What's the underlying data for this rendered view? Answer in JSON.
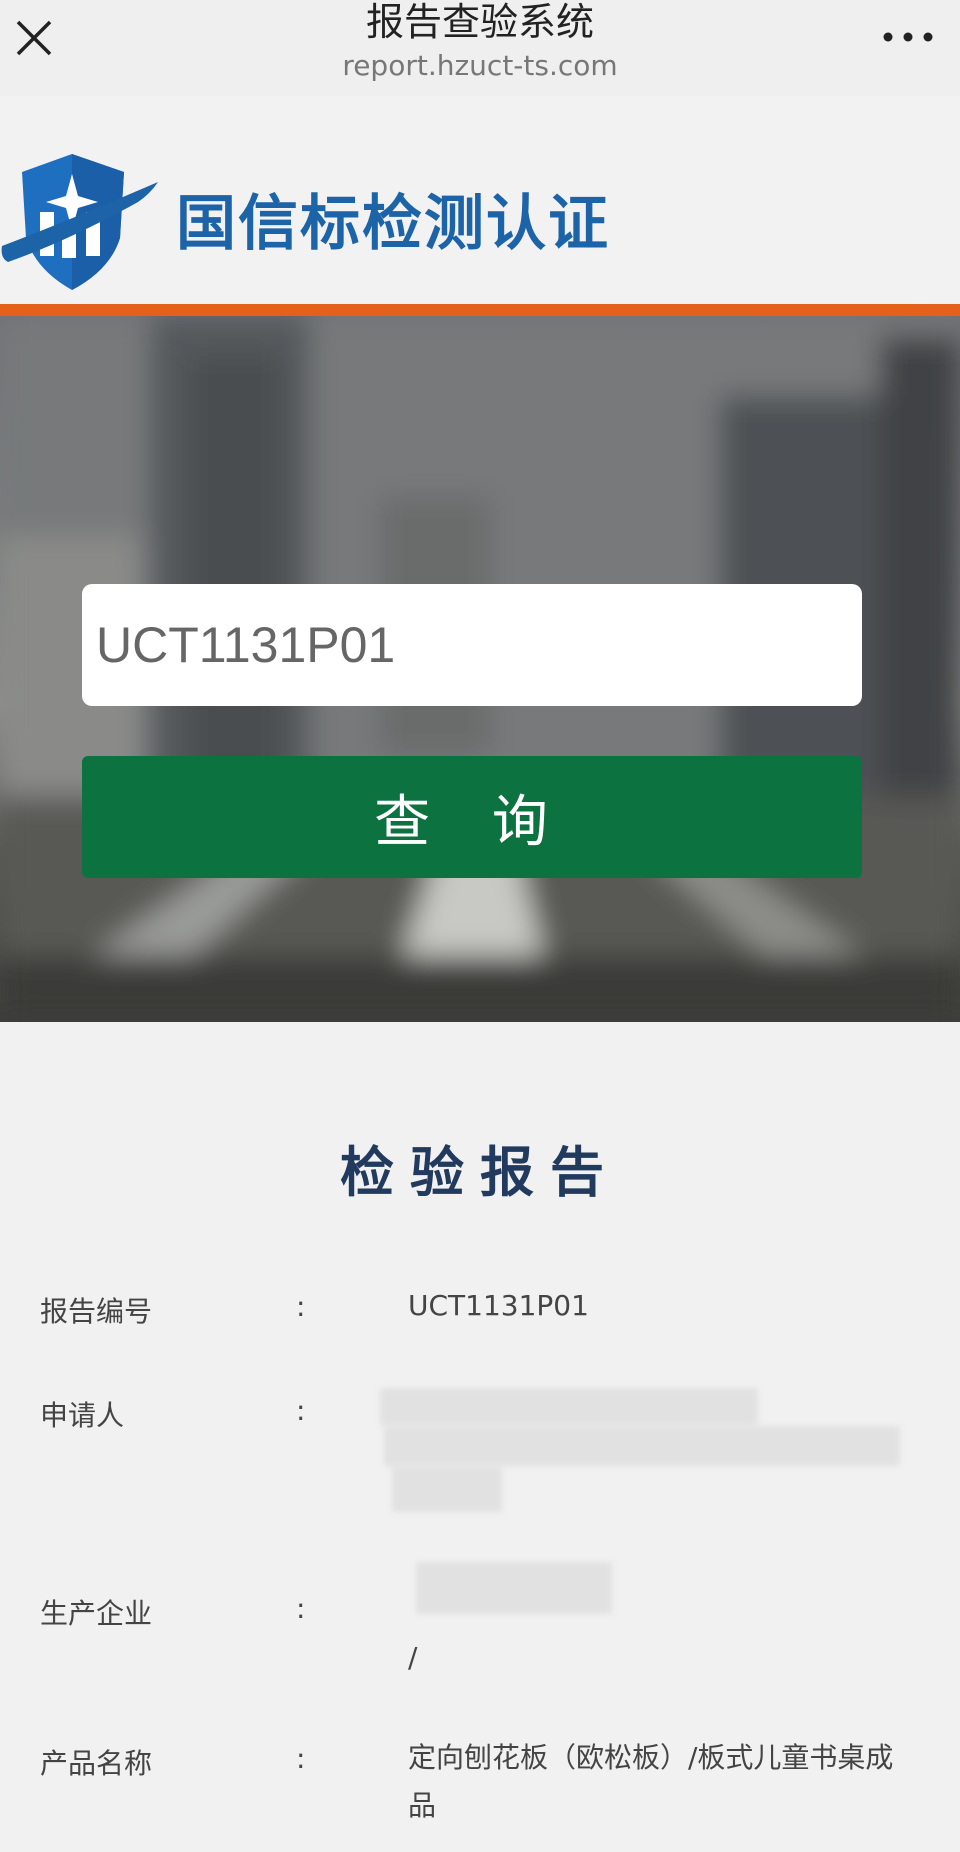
{
  "topbar": {
    "title": "报告查验系统",
    "url": "report.hzuct-ts.com"
  },
  "logo": {
    "text": "国信标检测认证",
    "brand_color": "#1d63a8",
    "accent_line_color": "#e3611a"
  },
  "search": {
    "input_value": "UCT1131P01",
    "button_label": "查 询",
    "button_color": "#0c7340"
  },
  "report": {
    "title": "检验报告",
    "rows": [
      {
        "label": "报告编号",
        "colon": ":",
        "value": "UCT1131P01"
      },
      {
        "label": "申请人",
        "colon": ":",
        "value": ""
      },
      {
        "label": "生产企业",
        "colon": ":",
        "value": "/"
      },
      {
        "label": "产品名称",
        "colon": ":",
        "value": "定向刨花板（欧松板）/板式儿童书桌成品"
      }
    ]
  }
}
